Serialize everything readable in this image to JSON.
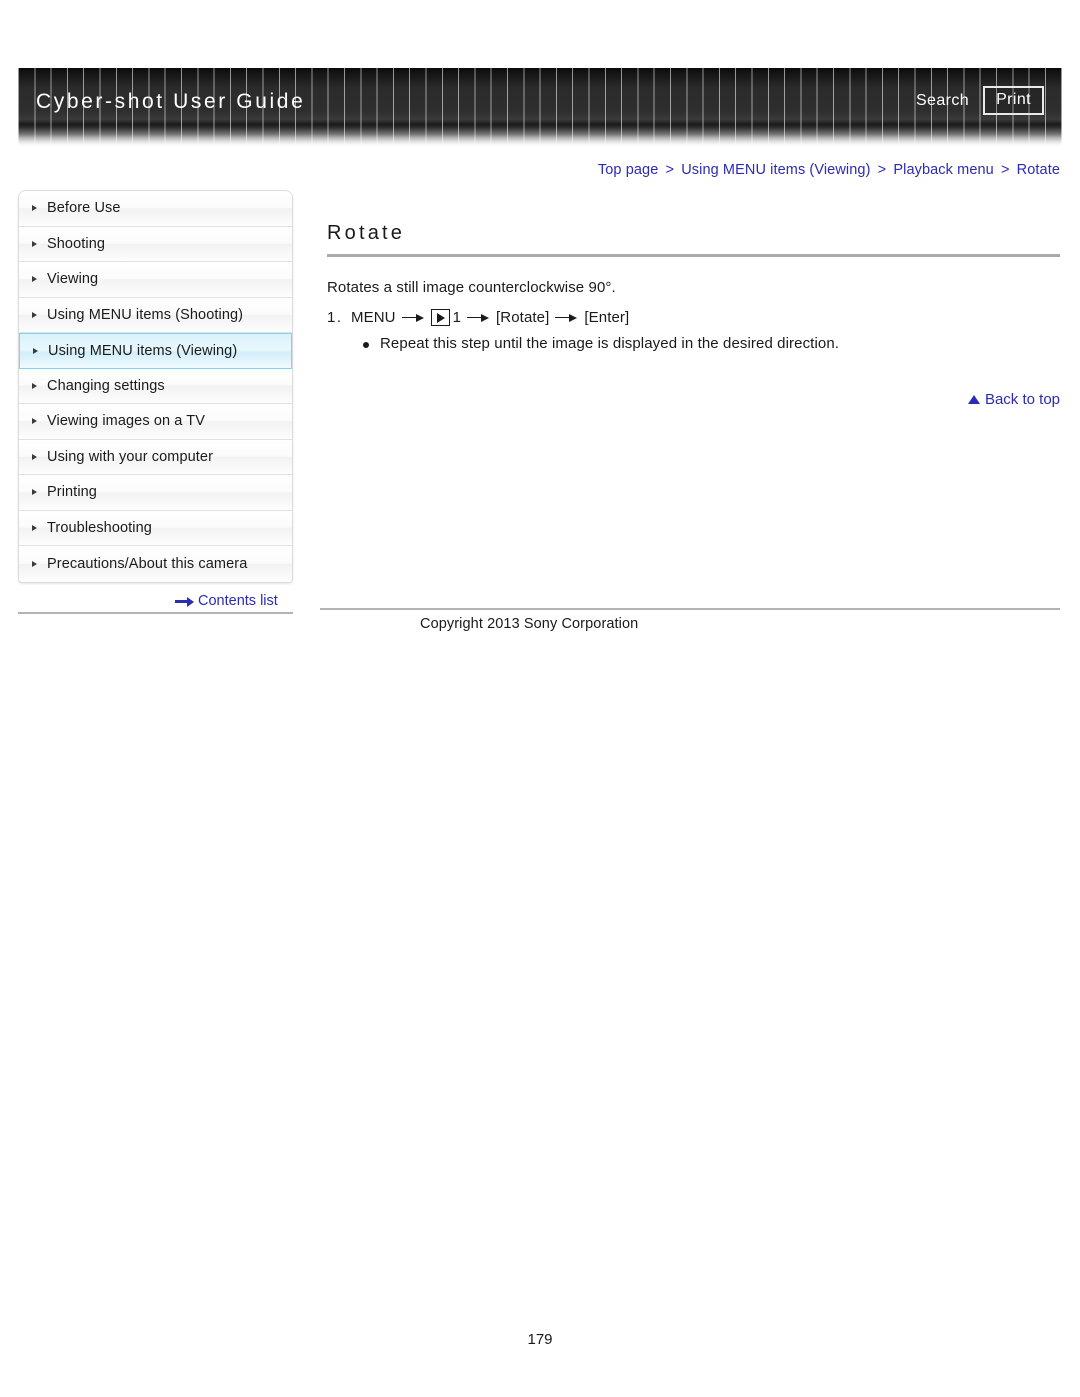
{
  "header": {
    "title": "Cyber-shot User Guide",
    "search_label": "Search",
    "print_label": "Print"
  },
  "breadcrumb": {
    "separator": ">",
    "items": [
      {
        "label": "Top page"
      },
      {
        "label": "Using MENU items (Viewing)"
      },
      {
        "label": "Playback menu"
      },
      {
        "label": "Rotate"
      }
    ]
  },
  "sidebar": {
    "items": [
      {
        "label": "Before Use",
        "active": false
      },
      {
        "label": "Shooting",
        "active": false
      },
      {
        "label": "Viewing",
        "active": false
      },
      {
        "label": "Using MENU items (Shooting)",
        "active": false
      },
      {
        "label": "Using MENU items (Viewing)",
        "active": true
      },
      {
        "label": "Changing settings",
        "active": false
      },
      {
        "label": "Viewing images on a TV",
        "active": false
      },
      {
        "label": "Using with your computer",
        "active": false
      },
      {
        "label": "Printing",
        "active": false
      },
      {
        "label": "Troubleshooting",
        "active": false
      },
      {
        "label": "Precautions/About this camera",
        "active": false
      }
    ],
    "contents_list_label": "Contents list"
  },
  "main": {
    "title": "Rotate",
    "lead": "Rotates a still image counterclockwise 90°.",
    "step": {
      "number": "1.",
      "menu_label": "MENU",
      "icon_name": "playback-icon",
      "tab_number": "1",
      "rotate_label": "[Rotate]",
      "enter_label": "[Enter]"
    },
    "note": "Repeat this step until the image is displayed in the desired direction.",
    "back_to_top_label": "Back to top"
  },
  "footer": {
    "copyright": "Copyright 2013 Sony Corporation",
    "page_number": "179"
  },
  "colors": {
    "link": "#2b2bb5",
    "active_nav_bg": "#ddf3fb",
    "active_nav_border": "#7fd4ee",
    "banner_dark": "#1a1a1a",
    "rule": "#b3b3b3"
  }
}
